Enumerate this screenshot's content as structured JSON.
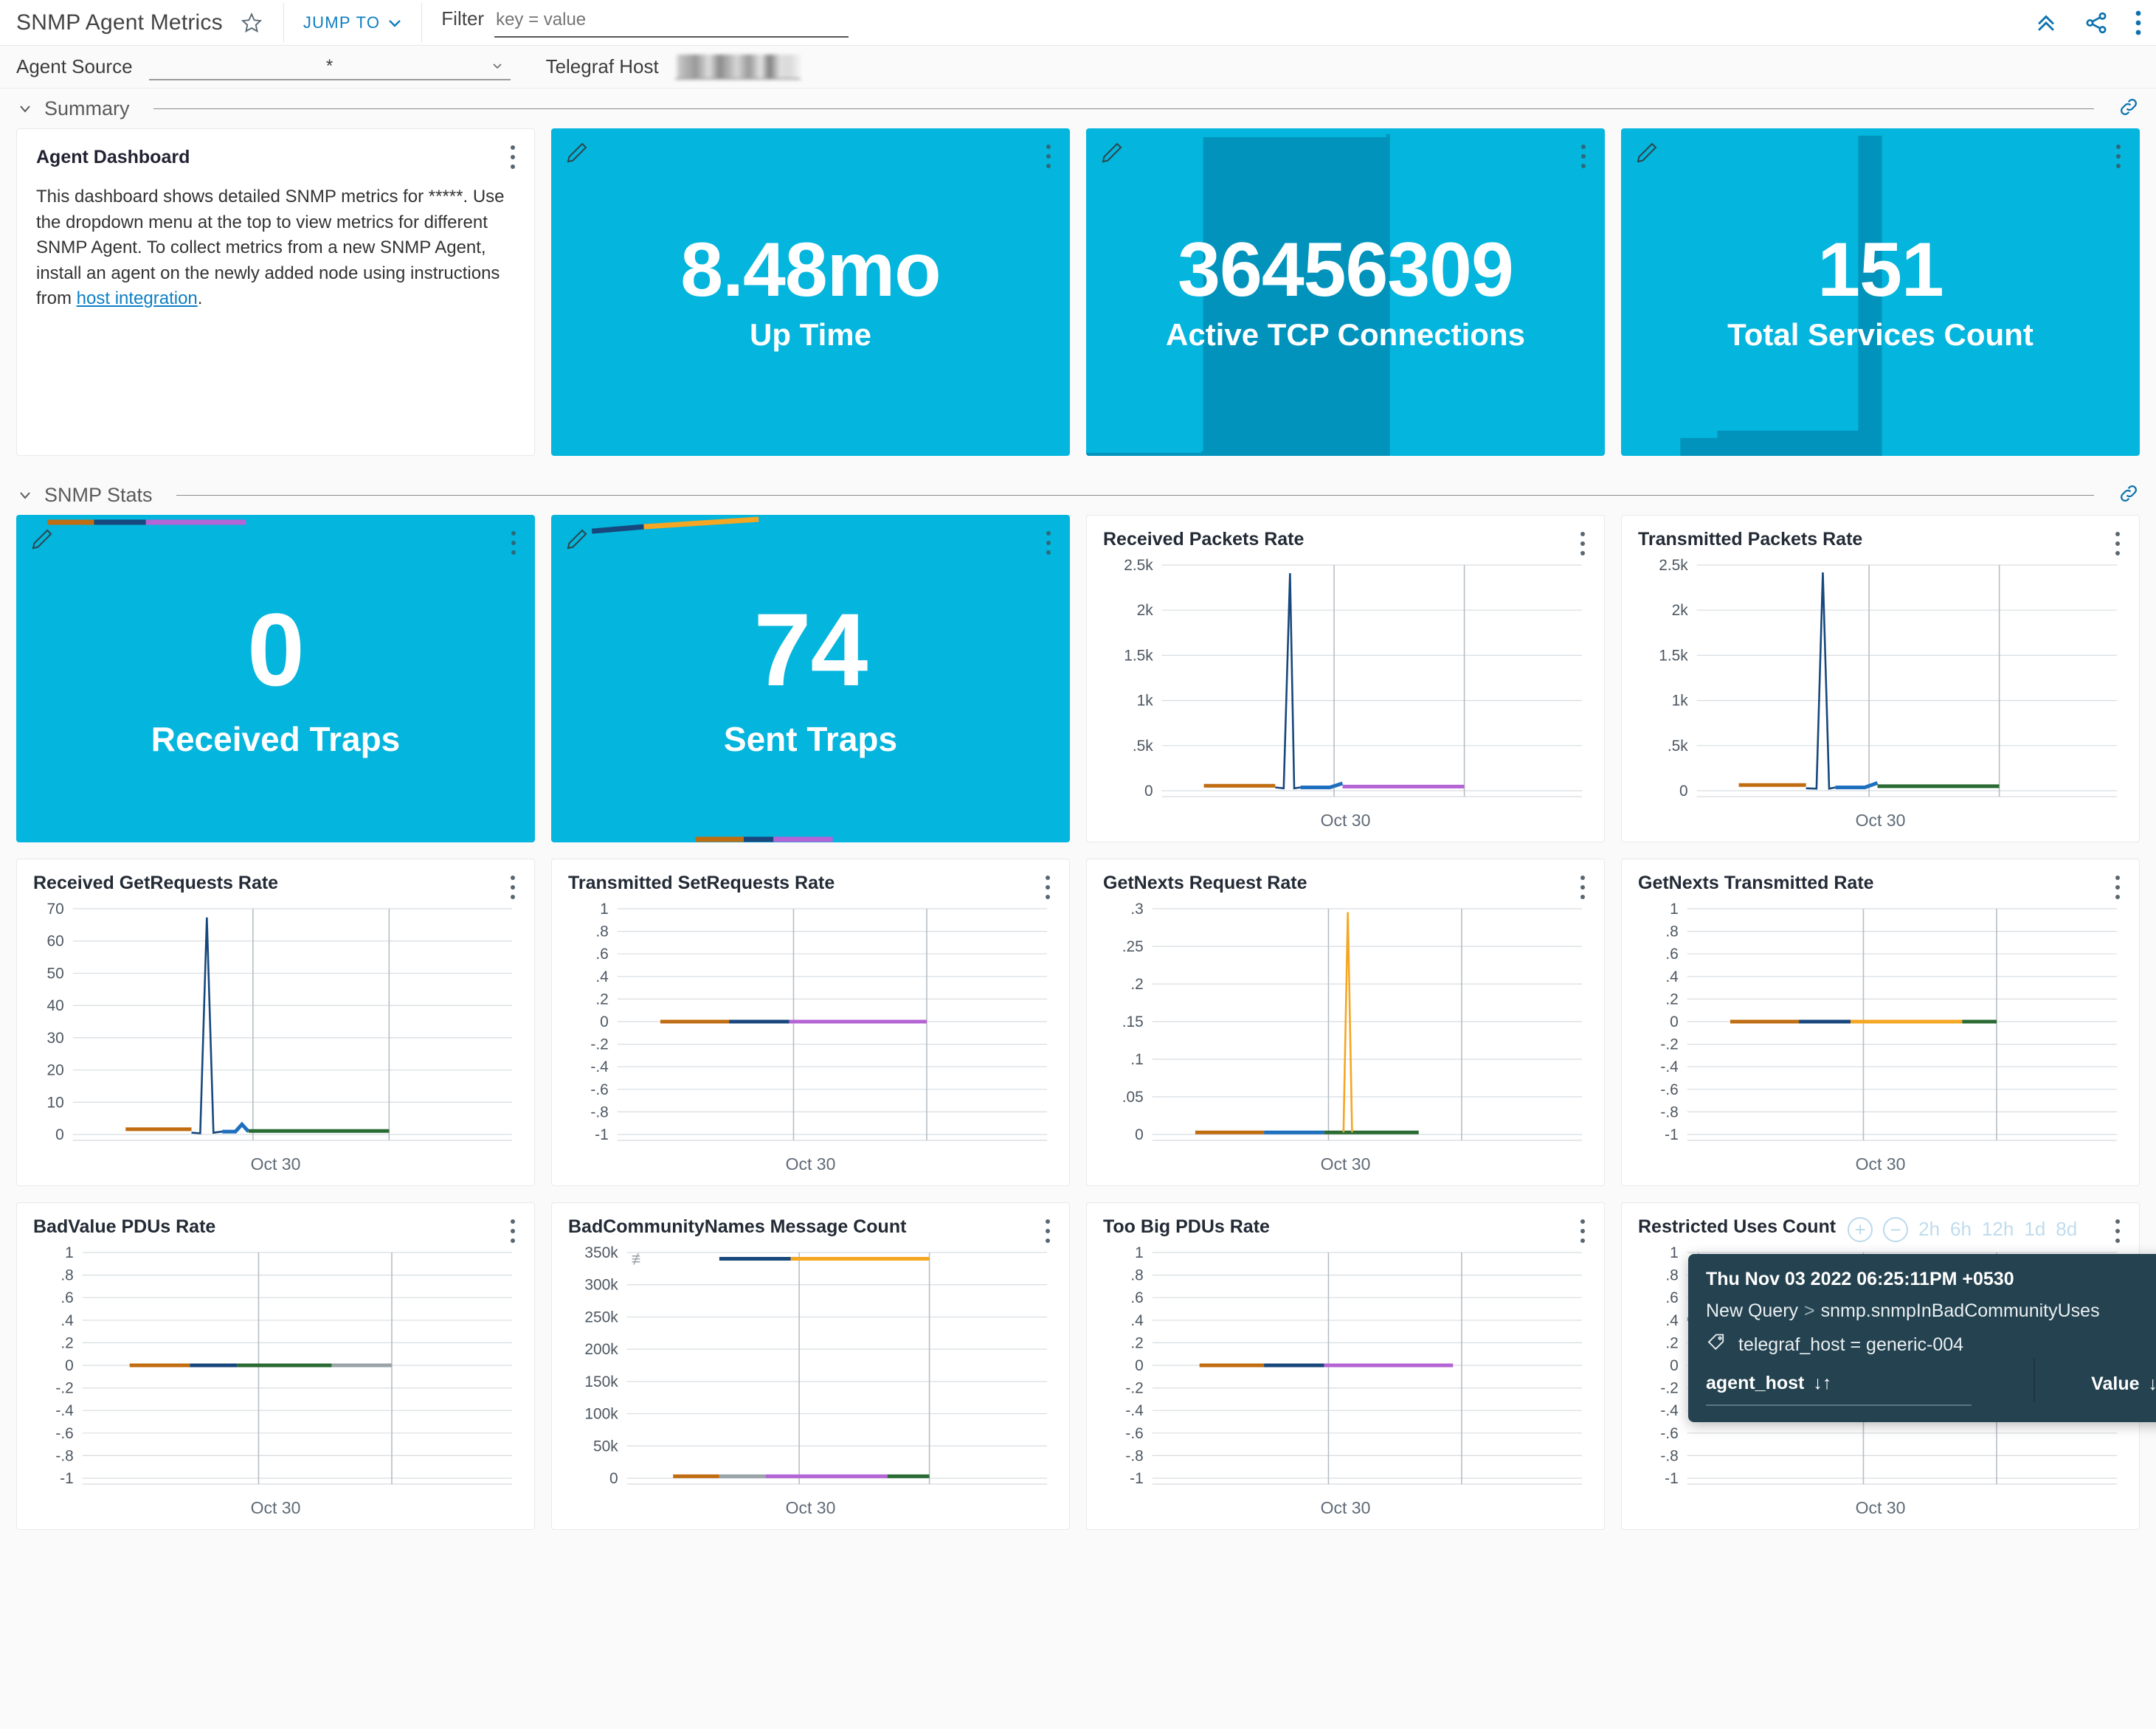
{
  "header": {
    "title": "SNMP Agent Metrics",
    "star_icon": "star-icon",
    "jump_to_label": "JUMP TO",
    "filter_label": "Filter",
    "filter_placeholder": "key = value",
    "filter_value": "",
    "collapse_icon": "double-chevron-up-icon",
    "share_icon": "share-icon",
    "menu_icon": "kebab-menu-icon"
  },
  "variables": {
    "agent_source_label": "Agent Source",
    "agent_source_value": "*",
    "telegraf_host_label": "Telegraf Host",
    "telegraf_host_value": ""
  },
  "sections": [
    {
      "name": "summary",
      "title": "Summary"
    },
    {
      "name": "snmp_stats",
      "title": "SNMP Stats"
    }
  ],
  "note": {
    "title": "Agent Dashboard",
    "text_before_link": "This dashboard shows detailed SNMP metrics for *****. Use the dropdown menu at the top to view metrics for different SNMP Agent. To collect metrics from a new SNMP Agent, install an agent on the newly added node using instructions from ",
    "link_text": "host integration",
    "text_after_link": "."
  },
  "stats": [
    {
      "name": "up-time",
      "value": "8.48mo",
      "label": "Up Time",
      "spark": "none"
    },
    {
      "name": "active-tcp-connections",
      "value": "36456309",
      "label": "Active TCP Connections",
      "spark": "band"
    },
    {
      "name": "total-services-count",
      "value": "151",
      "label": "Total Services Count",
      "spark": "step"
    },
    {
      "name": "received-traps",
      "value": "0",
      "label": "Received Traps",
      "spark": "lines-top"
    },
    {
      "name": "sent-traps",
      "value": "74",
      "label": "Sent Traps",
      "spark": "lines-slope"
    }
  ],
  "colors": {
    "accent_blue": "#0f7dbf",
    "tile_blue": "#04b5dd",
    "tile_blue_dark": "#0090b5",
    "series_orange": "#c06d12",
    "series_navy": "#17477c",
    "series_blue": "#1f6fbf",
    "series_purple": "#b464d4",
    "series_green": "#2a6b34",
    "series_gray": "#9aa3a8",
    "series_amber": "#f5a623",
    "tooltip_bg": "#24424f"
  },
  "time_range": {
    "zoom_in_label": "+",
    "zoom_out_label": "−",
    "options": [
      "2h",
      "6h",
      "12h",
      "1d",
      "8d"
    ]
  },
  "tooltip": {
    "timestamp": "Thu Nov 03 2022 06:25:11PM +0530",
    "query_name": "New Query",
    "query_sep": ">",
    "field": "snmp.snmpInBadCommunityUses",
    "tag_icon": "tag-icon",
    "tag_text": "telegraf_host = generic-004",
    "col_key": "agent_host",
    "col_key_sort": "↓↑",
    "col_value": "Value",
    "col_value_sort": "↓"
  },
  "chart_data": [
    {
      "name": "received-packets-rate",
      "type": "line",
      "title": "Received Packets Rate",
      "xlabel": "Oct 30",
      "ylabel": "",
      "yticks": [
        "0",
        ".5k",
        "1k",
        "1.5k",
        "2k",
        "2.5k"
      ],
      "ylim": [
        0,
        2750
      ],
      "xticks": [
        "Oct 30"
      ],
      "grid": true,
      "series": [
        {
          "name": "orange",
          "color": "#c06d12",
          "x": [
            0.1,
            0.27
          ],
          "values": [
            60,
            60
          ]
        },
        {
          "name": "navy-spike",
          "color": "#17477c",
          "x": [
            0.27,
            0.29,
            0.305,
            0.315,
            0.33
          ],
          "values": [
            40,
            30,
            2650,
            30,
            40
          ]
        },
        {
          "name": "blue",
          "color": "#1f6fbf",
          "x": [
            0.33,
            0.4,
            0.43
          ],
          "values": [
            40,
            40,
            90
          ]
        },
        {
          "name": "purple",
          "color": "#b464d4",
          "x": [
            0.43,
            0.72
          ],
          "values": [
            50,
            50
          ]
        }
      ]
    },
    {
      "name": "transmitted-packets-rate",
      "type": "line",
      "title": "Transmitted Packets Rate",
      "xlabel": "Oct 30",
      "ylabel": "",
      "yticks": [
        "0",
        ".5k",
        "1k",
        "1.5k",
        "2k",
        "2.5k"
      ],
      "ylim": [
        0,
        2750
      ],
      "xticks": [
        "Oct 30"
      ],
      "grid": true,
      "series": [
        {
          "name": "orange",
          "color": "#c06d12",
          "x": [
            0.1,
            0.26
          ],
          "values": [
            70,
            70
          ]
        },
        {
          "name": "navy-spike",
          "color": "#17477c",
          "x": [
            0.26,
            0.285,
            0.3,
            0.315,
            0.33
          ],
          "values": [
            30,
            25,
            2660,
            25,
            40
          ]
        },
        {
          "name": "blue",
          "color": "#1f6fbf",
          "x": [
            0.33,
            0.4,
            0.43
          ],
          "values": [
            40,
            40,
            95
          ]
        },
        {
          "name": "green",
          "color": "#2a6b34",
          "x": [
            0.43,
            0.72
          ],
          "values": [
            55,
            55
          ]
        }
      ]
    },
    {
      "name": "received-getrequests-rate",
      "type": "line",
      "title": "Received GetRequests Rate",
      "xlabel": "Oct 30",
      "ylabel": "",
      "yticks": [
        "0",
        "10",
        "20",
        "30",
        "40",
        "50",
        "60",
        "70"
      ],
      "ylim": [
        0,
        78
      ],
      "xticks": [
        "Oct 30"
      ],
      "grid": true,
      "series": [
        {
          "name": "orange",
          "color": "#c06d12",
          "x": [
            0.12,
            0.27
          ],
          "values": [
            1.8,
            1.8
          ]
        },
        {
          "name": "navy-spike",
          "color": "#17477c",
          "x": [
            0.27,
            0.29,
            0.305,
            0.32,
            0.34
          ],
          "values": [
            0.6,
            0.4,
            75,
            0.6,
            1.0
          ]
        },
        {
          "name": "blue",
          "color": "#1f6fbf",
          "x": [
            0.34,
            0.37,
            0.385,
            0.4
          ],
          "values": [
            1.0,
            1.0,
            3.5,
            1.0
          ]
        },
        {
          "name": "green",
          "color": "#2a6b34",
          "x": [
            0.4,
            0.72
          ],
          "values": [
            1.2,
            1.2
          ]
        }
      ]
    },
    {
      "name": "transmitted-setrequests-rate",
      "type": "line",
      "title": "Transmitted SetRequests Rate",
      "xlabel": "Oct 30",
      "ylabel": "",
      "yticks": [
        "-1",
        "-.8",
        "-.6",
        "-.4",
        "-.2",
        "0",
        ".2",
        ".4",
        ".6",
        ".8",
        "1"
      ],
      "ylim": [
        -1,
        1
      ],
      "xticks": [
        "Oct 30"
      ],
      "grid": true,
      "series": [
        {
          "name": "orange",
          "color": "#c06d12",
          "x": [
            0.1,
            0.26
          ],
          "values": [
            0,
            0
          ]
        },
        {
          "name": "navy",
          "color": "#17477c",
          "x": [
            0.26,
            0.4
          ],
          "values": [
            0,
            0
          ]
        },
        {
          "name": "purple",
          "color": "#b464d4",
          "x": [
            0.4,
            0.72
          ],
          "values": [
            0,
            0
          ]
        }
      ]
    },
    {
      "name": "getnexts-request-rate",
      "type": "line",
      "title": "GetNexts Request Rate",
      "xlabel": "Oct 30",
      "ylabel": "",
      "yticks": [
        "0",
        ".05",
        ".1",
        ".15",
        ".2",
        ".25",
        ".3"
      ],
      "ylim": [
        0,
        0.33
      ],
      "xticks": [
        "Oct 30"
      ],
      "grid": true,
      "series": [
        {
          "name": "orange",
          "color": "#c06d12",
          "x": [
            0.1,
            0.26
          ],
          "values": [
            0.003,
            0.003
          ]
        },
        {
          "name": "blue",
          "color": "#1f6fbf",
          "x": [
            0.26,
            0.4
          ],
          "values": [
            0.003,
            0.003
          ]
        },
        {
          "name": "green",
          "color": "#2a6b34",
          "x": [
            0.4,
            0.62
          ],
          "values": [
            0.003,
            0.003
          ]
        },
        {
          "name": "amber-spike",
          "color": "#f5a623",
          "x": [
            0.445,
            0.455,
            0.465
          ],
          "values": [
            0.003,
            0.325,
            0.003
          ]
        }
      ]
    },
    {
      "name": "getnexts-transmitted-rate",
      "type": "line",
      "title": "GetNexts Transmitted Rate",
      "xlabel": "Oct 30",
      "ylabel": "",
      "yticks": [
        "-1",
        "-.8",
        "-.6",
        "-.4",
        "-.2",
        "0",
        ".2",
        ".4",
        ".6",
        ".8",
        "1"
      ],
      "ylim": [
        -1,
        1
      ],
      "xticks": [
        "Oct 30"
      ],
      "grid": true,
      "series": [
        {
          "name": "orange",
          "color": "#c06d12",
          "x": [
            0.1,
            0.26
          ],
          "values": [
            0,
            0
          ]
        },
        {
          "name": "navy",
          "color": "#17477c",
          "x": [
            0.26,
            0.38
          ],
          "values": [
            0,
            0
          ]
        },
        {
          "name": "amber",
          "color": "#f5a623",
          "x": [
            0.38,
            0.64
          ],
          "values": [
            0,
            0
          ]
        },
        {
          "name": "green",
          "color": "#2a6b34",
          "x": [
            0.64,
            0.72
          ],
          "values": [
            0,
            0
          ]
        }
      ]
    },
    {
      "name": "badvalue-pdus-rate",
      "type": "line",
      "title": "BadValue PDUs Rate",
      "xlabel": "Oct 30",
      "ylabel": "",
      "yticks": [
        "-1",
        "-.8",
        "-.6",
        "-.4",
        "-.2",
        "0",
        ".2",
        ".4",
        ".6",
        ".8",
        "1"
      ],
      "ylim": [
        -1,
        1
      ],
      "xticks": [
        "Oct 30"
      ],
      "grid": true,
      "series": [
        {
          "name": "orange",
          "color": "#c06d12",
          "x": [
            0.11,
            0.25
          ],
          "values": [
            0,
            0
          ]
        },
        {
          "name": "navy",
          "color": "#17477c",
          "x": [
            0.25,
            0.36
          ],
          "values": [
            0,
            0
          ]
        },
        {
          "name": "green",
          "color": "#2a6b34",
          "x": [
            0.36,
            0.58
          ],
          "values": [
            0,
            0
          ]
        },
        {
          "name": "gray",
          "color": "#9aa3a8",
          "x": [
            0.58,
            0.72
          ],
          "values": [
            0,
            0
          ]
        }
      ]
    },
    {
      "name": "badcommunitynames-message-count",
      "type": "line",
      "title": "BadCommunityNames Message Count",
      "xlabel": "Oct 30",
      "ylabel": "",
      "yticks": [
        "0",
        "50k",
        "100k",
        "150k",
        "200k",
        "250k",
        "300k",
        "350k"
      ],
      "ylim": [
        0,
        360000
      ],
      "xticks": [
        "Oct 30"
      ],
      "grid": true,
      "series": [
        {
          "name": "navy-high",
          "color": "#17477c",
          "x": [
            0.22,
            0.39
          ],
          "values": [
            350000,
            350000
          ]
        },
        {
          "name": "amber-high",
          "color": "#f5a623",
          "x": [
            0.39,
            0.72
          ],
          "values": [
            350000,
            350000
          ]
        },
        {
          "name": "orange-low",
          "color": "#c06d12",
          "x": [
            0.11,
            0.22
          ],
          "values": [
            3000,
            3000
          ]
        },
        {
          "name": "gray-low",
          "color": "#9aa3a8",
          "x": [
            0.22,
            0.33
          ],
          "values": [
            3000,
            3000
          ]
        },
        {
          "name": "purple-low",
          "color": "#b464d4",
          "x": [
            0.33,
            0.62
          ],
          "values": [
            3000,
            3000
          ]
        },
        {
          "name": "green-low",
          "color": "#2a6b34",
          "x": [
            0.62,
            0.72
          ],
          "values": [
            3000,
            3000
          ]
        }
      ]
    },
    {
      "name": "too-big-pdus-rate",
      "type": "line",
      "title": "Too Big PDUs Rate",
      "xlabel": "Oct 30",
      "ylabel": "",
      "yticks": [
        "-1",
        "-.8",
        "-.6",
        "-.4",
        "-.2",
        "0",
        ".2",
        ".4",
        ".6",
        ".8",
        "1"
      ],
      "ylim": [
        -1,
        1
      ],
      "xticks": [
        "Oct 30"
      ],
      "grid": true,
      "series": [
        {
          "name": "orange",
          "color": "#c06d12",
          "x": [
            0.11,
            0.26
          ],
          "values": [
            0,
            0
          ]
        },
        {
          "name": "navy",
          "color": "#17477c",
          "x": [
            0.26,
            0.4
          ],
          "values": [
            0,
            0
          ]
        },
        {
          "name": "purple",
          "color": "#b464d4",
          "x": [
            0.4,
            0.7
          ],
          "values": [
            0,
            0
          ]
        }
      ]
    },
    {
      "name": "restricted-uses-count",
      "type": "line",
      "title": "Restricted Uses Count",
      "xlabel": "Oct 30",
      "ylabel": "",
      "yticks": [
        "-1",
        "-.8",
        "-.6",
        "-.4",
        "-.2",
        "0",
        ".2",
        ".4",
        ".6",
        ".8",
        "1"
      ],
      "ylim": [
        -1,
        1
      ],
      "xticks": [
        "Oct 30"
      ],
      "grid": true,
      "series": [
        {
          "name": "gray-line",
          "color": "#9aa3a8",
          "x": [
            0.0,
            1.0
          ],
          "values": [
            0.41,
            0.41
          ]
        },
        {
          "name": "orange",
          "color": "#c06d12",
          "x": [
            0.11,
            0.25
          ],
          "values": [
            0,
            0
          ]
        },
        {
          "name": "navy",
          "color": "#17477c",
          "x": [
            0.25,
            0.39
          ],
          "values": [
            0,
            0
          ]
        },
        {
          "name": "purple",
          "color": "#b464d4",
          "x": [
            0.39,
            0.72
          ],
          "values": [
            0,
            0
          ]
        }
      ]
    }
  ]
}
